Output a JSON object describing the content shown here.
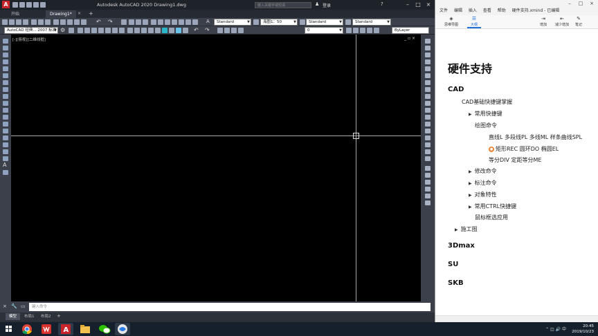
{
  "autocad": {
    "title": "Autodesk AutoCAD 2020    Drawing1.dwg",
    "search_placeholder": "键入关键字或短语",
    "user_label": "登录",
    "file_tabs": [
      {
        "label": "开始"
      },
      {
        "label": "Drawing1*"
      }
    ],
    "new_tab_symbol": "+",
    "toolbar": {
      "text_style": "Standard",
      "annotation_scale": "海图1：50",
      "dim_style": "Standard",
      "table_style": "Standard",
      "workspace": "AutoCAD 经典... 2007 标准",
      "layer": "0",
      "linetype": "ByLayer"
    },
    "viewport_label": "[-][俯视][二维线框]",
    "viewport_controls": "_ ▫ ×",
    "command_placeholder": "键入命令",
    "layout_tabs": [
      {
        "label": "模型",
        "active": true
      },
      {
        "label": "布局1",
        "active": false
      },
      {
        "label": "布局2",
        "active": false
      }
    ],
    "layout_add": "+"
  },
  "xmind": {
    "menu": [
      "文件",
      "编辑",
      "插入",
      "查看",
      "帮助"
    ],
    "doc_title": "硬件支持.xmind - 已编辑",
    "tools": [
      {
        "label": "思维导图",
        "icon": "mindmap-icon"
      },
      {
        "label": "大纲",
        "icon": "outline-icon",
        "active": true
      },
      {
        "label": "增加",
        "icon": "add-icon"
      },
      {
        "label": "减少增加",
        "icon": "remove-icon"
      },
      {
        "label": "笔记",
        "icon": "note-icon"
      }
    ],
    "outline": {
      "root": "硬件支持",
      "cad": "CAD",
      "cad_shortcuts": "CAD基础快捷键掌握",
      "common_shortcuts": "常用快捷键",
      "draw_commands": "绘图命令",
      "line_cmds": "直线L  多段线PL  多线ML  样条曲线SPL",
      "rect_cmds": "矩形REC  圆环DO  椭圆EL",
      "div_cmds": "等分DIV  定距等分ME",
      "modify": "修改命令",
      "annotate": "标注命令",
      "properties": "对象特性",
      "ctrl_shortcuts": "常用CTRL快捷键",
      "mouse_select": "鼠标框选应用",
      "construction": "施工图",
      "max": "3Dmax",
      "su": "SU",
      "skb": "SKB"
    }
  },
  "taskbar": {
    "time": "20:45",
    "date": "2019/10/23"
  },
  "colors": {
    "cad_bg": "#2b2f38",
    "canvas": "#000000",
    "accent": "#1e6fd9",
    "taskbar": "#15202c"
  }
}
